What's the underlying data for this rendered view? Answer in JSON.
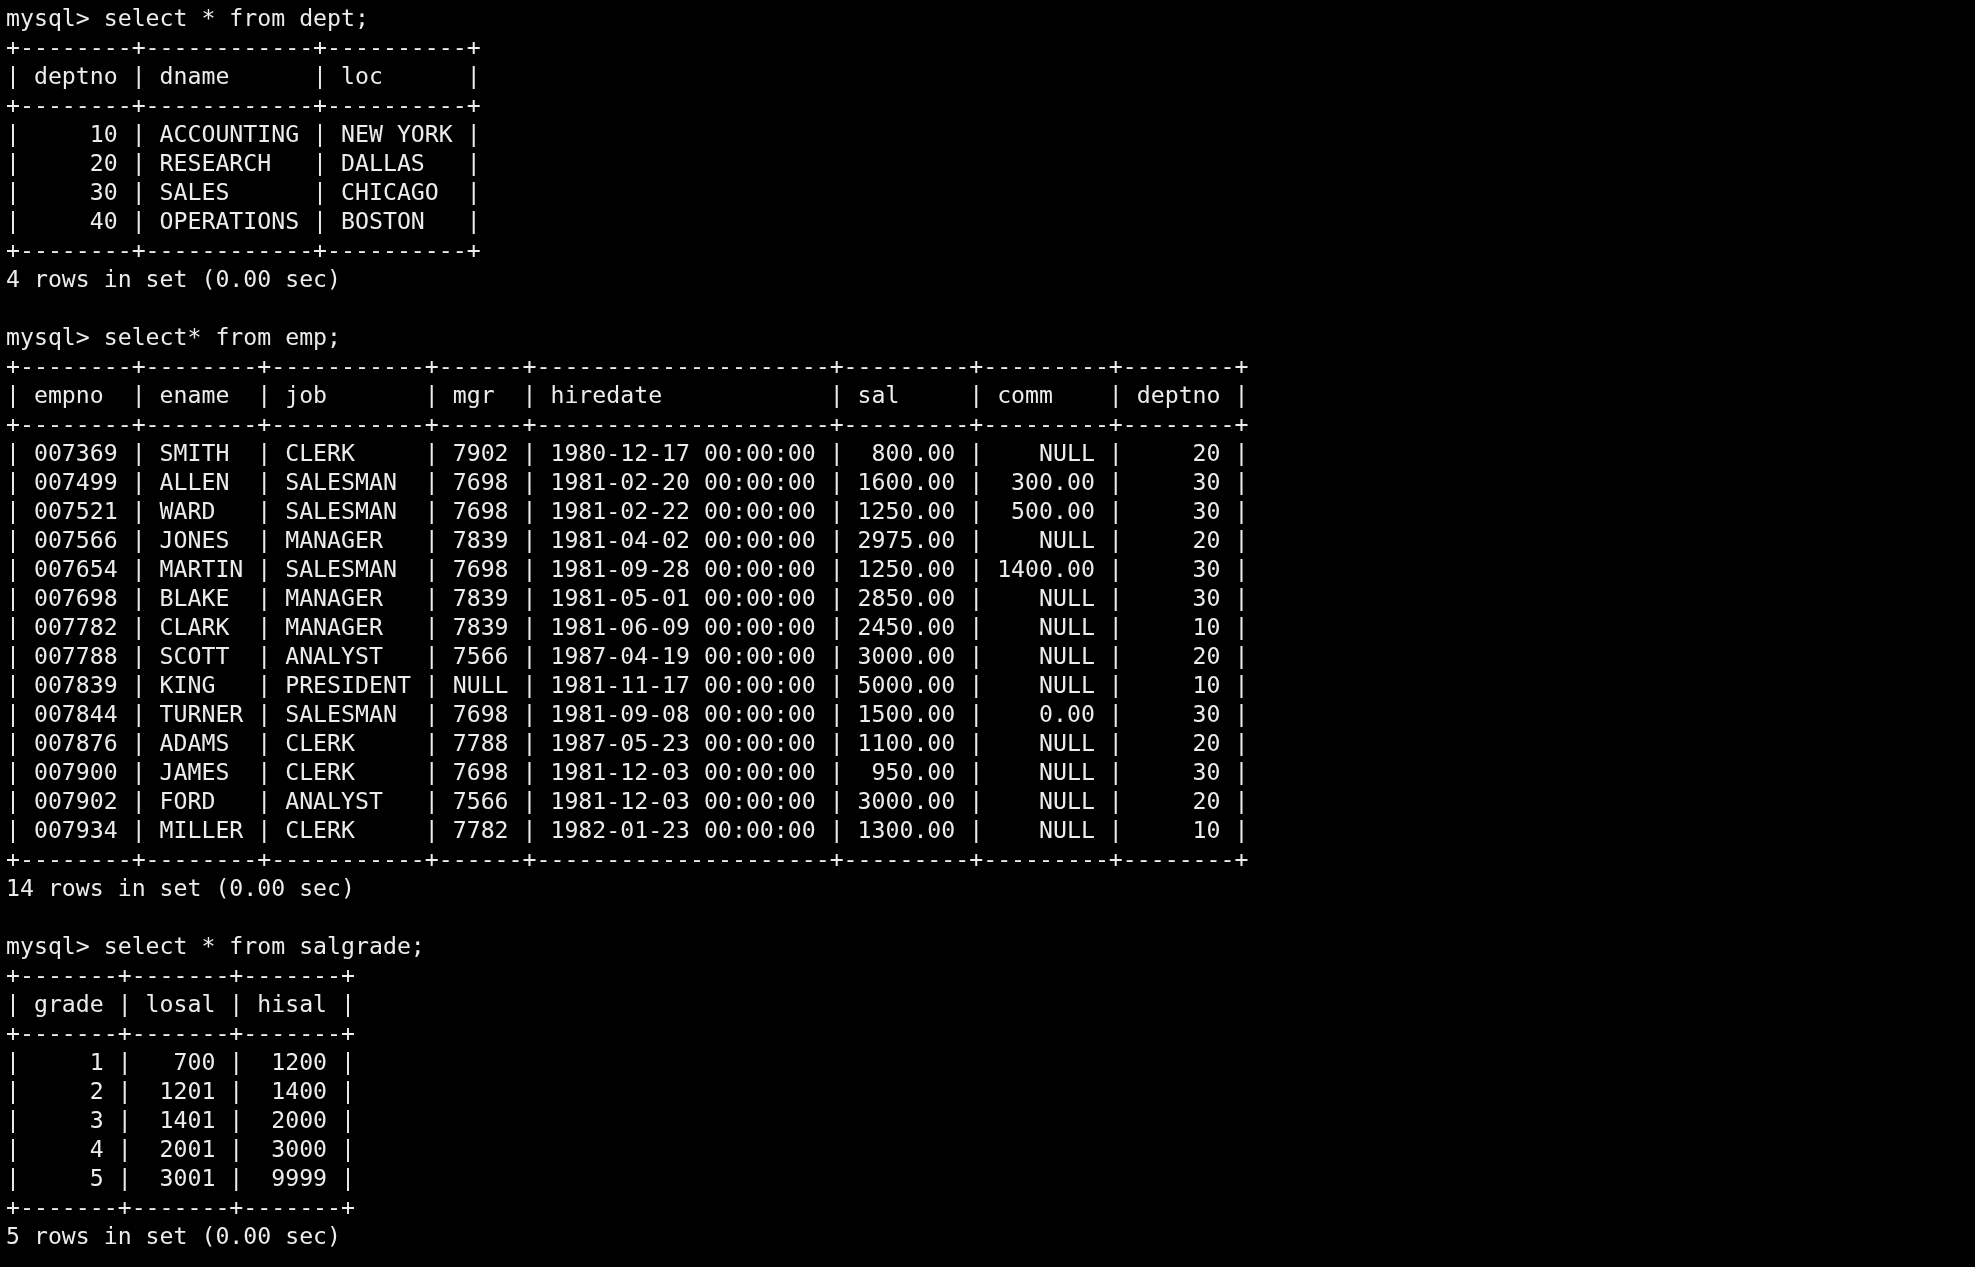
{
  "terminal": {
    "blocks": [
      {
        "lines": [
          "mysql> select * from dept;",
          "+--------+------------+----------+",
          "| deptno | dname      | loc      |",
          "+--------+------------+----------+",
          "|     10 | ACCOUNTING | NEW YORK |",
          "|     20 | RESEARCH   | DALLAS   |",
          "|     30 | SALES      | CHICAGO  |",
          "|     40 | OPERATIONS | BOSTON   |",
          "+--------+------------+----------+",
          "4 rows in set (0.00 sec)"
        ]
      },
      {
        "lines": [
          "mysql> select* from emp;",
          "+--------+--------+-----------+------+---------------------+---------+---------+--------+",
          "| empno  | ename  | job       | mgr  | hiredate            | sal     | comm    | deptno |",
          "+--------+--------+-----------+------+---------------------+---------+---------+--------+",
          "| 007369 | SMITH  | CLERK     | 7902 | 1980-12-17 00:00:00 |  800.00 |    NULL |     20 |",
          "| 007499 | ALLEN  | SALESMAN  | 7698 | 1981-02-20 00:00:00 | 1600.00 |  300.00 |     30 |",
          "| 007521 | WARD   | SALESMAN  | 7698 | 1981-02-22 00:00:00 | 1250.00 |  500.00 |     30 |",
          "| 007566 | JONES  | MANAGER   | 7839 | 1981-04-02 00:00:00 | 2975.00 |    NULL |     20 |",
          "| 007654 | MARTIN | SALESMAN  | 7698 | 1981-09-28 00:00:00 | 1250.00 | 1400.00 |     30 |",
          "| 007698 | BLAKE  | MANAGER   | 7839 | 1981-05-01 00:00:00 | 2850.00 |    NULL |     30 |",
          "| 007782 | CLARK  | MANAGER   | 7839 | 1981-06-09 00:00:00 | 2450.00 |    NULL |     10 |",
          "| 007788 | SCOTT  | ANALYST   | 7566 | 1987-04-19 00:00:00 | 3000.00 |    NULL |     20 |",
          "| 007839 | KING   | PRESIDENT | NULL | 1981-11-17 00:00:00 | 5000.00 |    NULL |     10 |",
          "| 007844 | TURNER | SALESMAN  | 7698 | 1981-09-08 00:00:00 | 1500.00 |    0.00 |     30 |",
          "| 007876 | ADAMS  | CLERK     | 7788 | 1987-05-23 00:00:00 | 1100.00 |    NULL |     20 |",
          "| 007900 | JAMES  | CLERK     | 7698 | 1981-12-03 00:00:00 |  950.00 |    NULL |     30 |",
          "| 007902 | FORD   | ANALYST   | 7566 | 1981-12-03 00:00:00 | 3000.00 |    NULL |     20 |",
          "| 007934 | MILLER | CLERK     | 7782 | 1982-01-23 00:00:00 | 1300.00 |    NULL |     10 |",
          "+--------+--------+-----------+------+---------------------+---------+---------+--------+",
          "14 rows in set (0.00 sec)"
        ]
      },
      {
        "lines": [
          "mysql> select * from salgrade;",
          "+-------+-------+-------+",
          "| grade | losal | hisal |",
          "+-------+-------+-------+",
          "|     1 |   700 |  1200 |",
          "|     2 |  1201 |  1400 |",
          "|     3 |  1401 |  2000 |",
          "|     4 |  2001 |  3000 |",
          "|     5 |  3001 |  9999 |",
          "+-------+-------+-------+",
          "5 rows in set (0.00 sec)"
        ]
      }
    ]
  }
}
